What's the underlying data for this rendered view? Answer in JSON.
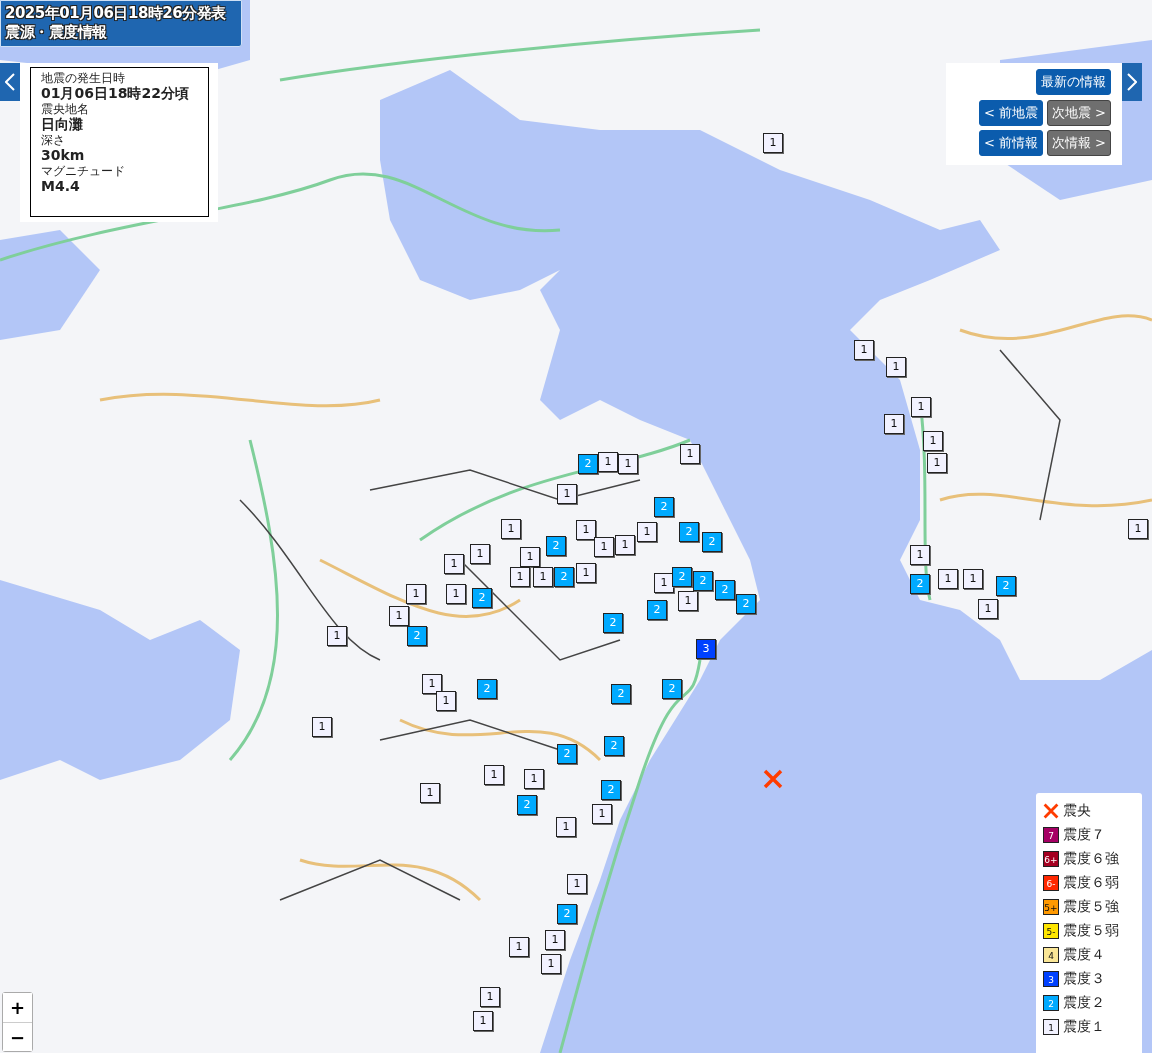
{
  "header": {
    "title_lines": [
      "2025年01月06日18時26分発表",
      "震源・震度情報"
    ]
  },
  "info_panel": {
    "fields": [
      {
        "label": "地震の発生日時",
        "value": "01月06日18時22分頃"
      },
      {
        "label": "震央地名",
        "value": "日向灘"
      },
      {
        "label": "深さ",
        "value": "30km"
      },
      {
        "label": "マグニチュード",
        "value": "M4.4"
      }
    ]
  },
  "nav_panel": {
    "latest_button": "最新の情報",
    "buttons": [
      {
        "label": "< 前地震",
        "disabled": false
      },
      {
        "label": "次地震 >",
        "disabled": true
      },
      {
        "label": "< 前情報",
        "disabled": false
      },
      {
        "label": "次情報 >",
        "disabled": true
      }
    ]
  },
  "legend": [
    {
      "kind": "epicenter",
      "label": "震央"
    },
    {
      "kind": "intensity",
      "symbol": "7",
      "label": "震度７",
      "color": "#a50064"
    },
    {
      "kind": "intensity",
      "symbol": "6+",
      "label": "震度６強",
      "color": "#a50021"
    },
    {
      "kind": "intensity",
      "symbol": "6-",
      "label": "震度６弱",
      "color": "#ff2800"
    },
    {
      "kind": "intensity",
      "symbol": "5+",
      "label": "震度５強",
      "color": "#ff9900"
    },
    {
      "kind": "intensity",
      "symbol": "5-",
      "label": "震度５弱",
      "color": "#ffe600"
    },
    {
      "kind": "intensity",
      "symbol": "4",
      "label": "震度４",
      "color": "#fae696"
    },
    {
      "kind": "intensity",
      "symbol": "3",
      "label": "震度３",
      "color": "#0041ff"
    },
    {
      "kind": "intensity",
      "symbol": "2",
      "label": "震度２",
      "color": "#00aaff"
    },
    {
      "kind": "intensity",
      "symbol": "1",
      "label": "震度１",
      "color": "#f2f2ff"
    }
  ],
  "zoom": {
    "in": "+",
    "out": "−"
  },
  "markers": [
    {
      "label": "1",
      "color": "#f2f2ff"
    },
    {
      "label": "2",
      "color": "#00aaff"
    },
    {
      "label": "1",
      "color": "#f2f2ff"
    },
    {
      "label": "1",
      "color": "#f2f2ff"
    },
    {
      "label": "1",
      "color": "#f2f2ff"
    },
    {
      "label": "1",
      "color": "#f2f2ff"
    },
    {
      "label": "2",
      "color": "#00aaff"
    },
    {
      "label": "1",
      "color": "#f2f2ff"
    },
    {
      "label": "1",
      "color": "#f2f2ff"
    },
    {
      "label": "1",
      "color": "#f2f2ff"
    },
    {
      "label": "1",
      "color": "#f2f2ff"
    },
    {
      "label": "2",
      "color": "#00aaff"
    },
    {
      "label": "2",
      "color": "#00aaff"
    },
    {
      "label": "2",
      "color": "#00aaff"
    },
    {
      "label": "1",
      "color": "#f2f2ff"
    },
    {
      "label": "1",
      "color": "#f2f2ff"
    },
    {
      "label": "1",
      "color": "#f2f2ff"
    },
    {
      "label": "1",
      "color": "#f2f2ff"
    },
    {
      "label": "1",
      "color": "#f2f2ff"
    },
    {
      "label": "1",
      "color": "#f2f2ff"
    },
    {
      "label": "1",
      "color": "#f2f2ff"
    },
    {
      "label": "2",
      "color": "#00aaff"
    },
    {
      "label": "1",
      "color": "#f2f2ff"
    },
    {
      "label": "1",
      "color": "#f2f2ff"
    },
    {
      "label": "2",
      "color": "#00aaff"
    },
    {
      "label": "2",
      "color": "#00aaff"
    },
    {
      "label": "2",
      "color": "#00aaff"
    },
    {
      "label": "2",
      "color": "#00aaff"
    },
    {
      "label": "2",
      "color": "#00aaff"
    },
    {
      "label": "1",
      "color": "#f2f2ff"
    },
    {
      "label": "1",
      "color": "#f2f2ff"
    },
    {
      "label": "2",
      "color": "#00aaff"
    },
    {
      "label": "1",
      "color": "#f2f2ff"
    },
    {
      "label": "2",
      "color": "#00aaff"
    },
    {
      "label": "1",
      "color": "#f2f2ff"
    },
    {
      "label": "2",
      "color": "#00aaff"
    },
    {
      "label": "3",
      "color": "#0041ff"
    },
    {
      "label": "1",
      "color": "#f2f2ff"
    },
    {
      "label": "1",
      "color": "#f2f2ff"
    },
    {
      "label": "2",
      "color": "#00aaff"
    },
    {
      "label": "2",
      "color": "#00aaff"
    },
    {
      "label": "2",
      "color": "#00aaff"
    },
    {
      "label": "1",
      "color": "#f2f2ff"
    },
    {
      "label": "2",
      "color": "#00aaff"
    },
    {
      "label": "2",
      "color": "#00aaff"
    },
    {
      "label": "1",
      "color": "#f2f2ff"
    },
    {
      "label": "1",
      "color": "#f2f2ff"
    },
    {
      "label": "1",
      "color": "#f2f2ff"
    },
    {
      "label": "2",
      "color": "#00aaff"
    },
    {
      "label": "1",
      "color": "#f2f2ff"
    },
    {
      "label": "2",
      "color": "#00aaff"
    },
    {
      "label": "1",
      "color": "#f2f2ff"
    },
    {
      "label": "1",
      "color": "#f2f2ff"
    },
    {
      "label": "2",
      "color": "#00aaff"
    },
    {
      "label": "1",
      "color": "#f2f2ff"
    },
    {
      "label": "1",
      "color": "#f2f2ff"
    },
    {
      "label": "1",
      "color": "#f2f2ff"
    },
    {
      "label": "1",
      "color": "#f2f2ff"
    },
    {
      "label": "1",
      "color": "#f2f2ff"
    },
    {
      "label": "1",
      "color": "#f2f2ff"
    },
    {
      "label": "1",
      "color": "#f2f2ff"
    },
    {
      "label": "1",
      "color": "#f2f2ff"
    },
    {
      "label": "1",
      "color": "#f2f2ff"
    },
    {
      "label": "1",
      "color": "#f2f2ff"
    },
    {
      "label": "1",
      "color": "#f2f2ff"
    },
    {
      "label": "1",
      "color": "#f2f2ff"
    },
    {
      "label": "1",
      "color": "#f2f2ff"
    },
    {
      "label": "2",
      "color": "#00aaff"
    },
    {
      "label": "1",
      "color": "#f2f2ff"
    },
    {
      "label": "1",
      "color": "#f2f2ff"
    },
    {
      "label": "2",
      "color": "#00aaff"
    },
    {
      "label": "1",
      "color": "#f2f2ff"
    }
  ]
}
